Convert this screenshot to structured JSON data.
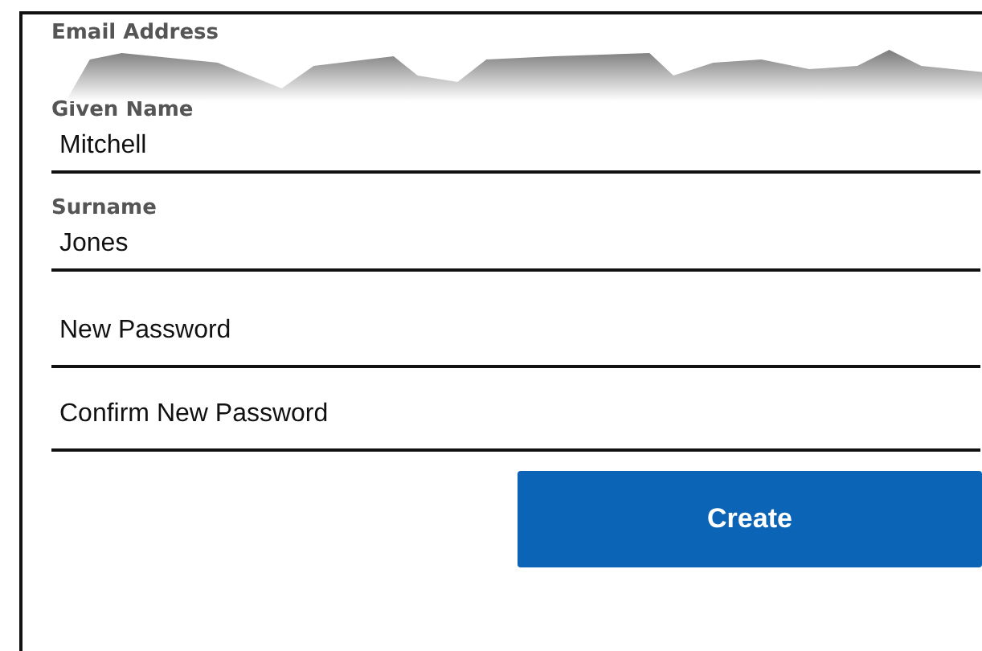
{
  "email_label": "Email Address",
  "fields": [
    {
      "label": "Given Name",
      "value": "Mitchell"
    },
    {
      "label": "Surname",
      "value": "Jones"
    },
    {
      "placeholder": "New Password"
    },
    {
      "placeholder": "Confirm New Password"
    }
  ],
  "button": "Create"
}
